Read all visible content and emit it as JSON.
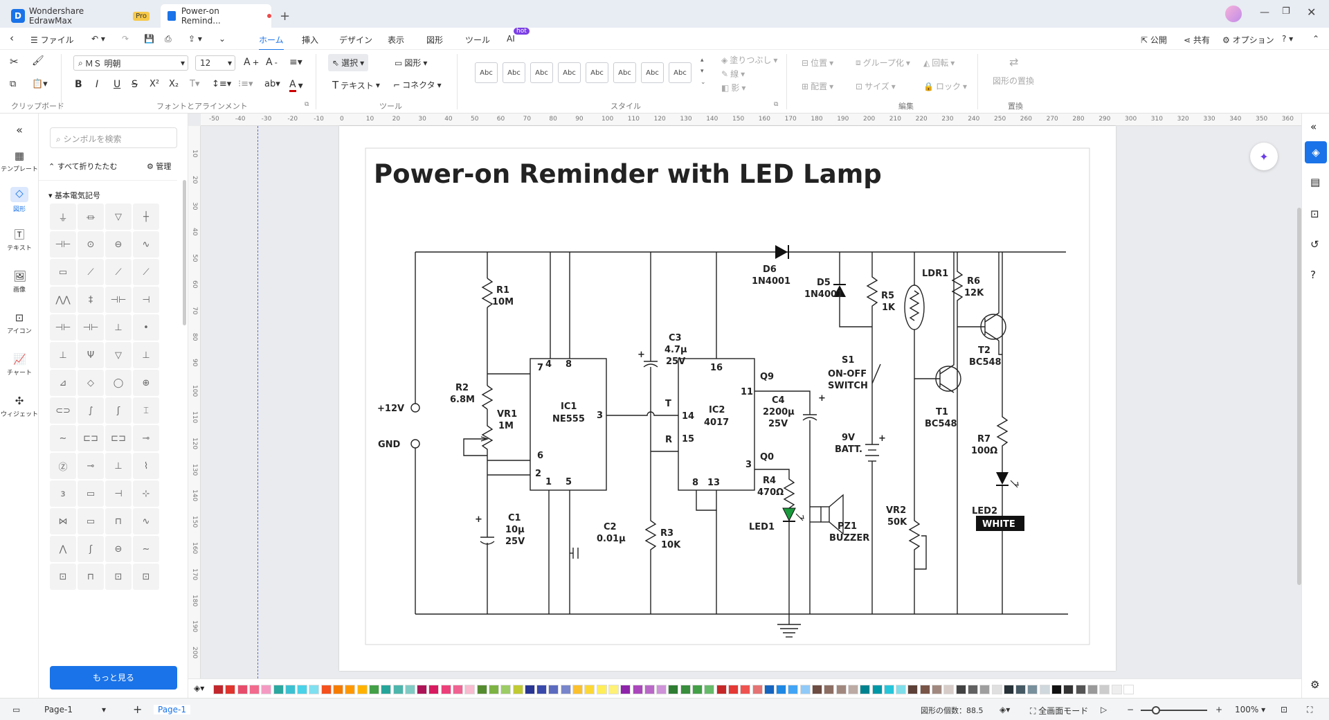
{
  "titlebar": {
    "app_name": "Wondershare EdrawMax",
    "pro_badge": "Pro",
    "doc_tab": "Power-on Remind...",
    "new_tab": "+"
  },
  "menubar": {
    "file": "ファイル",
    "tabs": [
      "ホーム",
      "挿入",
      "デザイン",
      "表示",
      "図形",
      "ツール",
      "AI"
    ],
    "ai_badge": "hot",
    "publish": "公開",
    "share": "共有",
    "options": "オプション"
  },
  "ribbon": {
    "font_name": "ＭＳ 明朝",
    "font_size": "12",
    "select": "選択",
    "shape": "図形",
    "text": "テキスト",
    "connector": "コネクタ",
    "style_swatch": "Abc",
    "fill": "塗りつぶし",
    "line": "線",
    "shadow": "影",
    "position": "位置",
    "align": "配置",
    "group": "グループ化",
    "size": "サイズ",
    "rotate": "回転",
    "lock": "ロック",
    "replace_shape": "図形の置換",
    "groups": {
      "clipboard": "クリップボード",
      "font": "フォントとアラインメント",
      "tools": "ツール",
      "style": "スタイル",
      "edit": "編集",
      "replace": "置換"
    }
  },
  "leftbar": [
    "テンプレート",
    "図形",
    "テキスト",
    "画像",
    "アイコン",
    "チャート",
    "ウィジェット"
  ],
  "library": {
    "search_placeholder": "シンボルを検索",
    "collapse_all": "すべて折りたたむ",
    "manage": "管理",
    "category": "基本電気記号",
    "more": "もっと見る"
  },
  "ruler": {
    "h": [
      "-50",
      "-40",
      "-30",
      "-20",
      "-10",
      "0",
      "10",
      "20",
      "30",
      "40",
      "50",
      "60",
      "70",
      "80",
      "90",
      "100",
      "110",
      "120",
      "130",
      "140",
      "150",
      "160",
      "170",
      "180",
      "190",
      "200",
      "210",
      "220",
      "230",
      "240",
      "250",
      "260",
      "270",
      "280",
      "290",
      "300",
      "310",
      "320",
      "330",
      "340",
      "350",
      "360"
    ],
    "v": [
      "10",
      "20",
      "30",
      "40",
      "50",
      "60",
      "70",
      "80",
      "90",
      "100",
      "110",
      "120",
      "130",
      "140",
      "150",
      "160",
      "170",
      "180",
      "190",
      "200"
    ]
  },
  "diagram": {
    "title": "Power-on Reminder with LED Lamp",
    "labels": {
      "r1": "R1",
      "r1v": "10M",
      "r2": "R2",
      "r2v": "6.8M",
      "vr1": "VR1",
      "vr1v": "1M",
      "c1": "C1",
      "c1v": "10µ",
      "c1v2": "25V",
      "ic1": "IC1",
      "ic1v": "NE555",
      "c2": "C2",
      "c2v": "0.01µ",
      "c3": "C3",
      "c3v": "4.7µ",
      "c3v2": "25V",
      "r3": "R3",
      "r3v": "10K",
      "ic2": "IC2",
      "ic2v": "4017",
      "t": "T",
      "r": "R",
      "q9": "Q9",
      "q0": "Q0",
      "c4": "C4",
      "c4v": "2200µ",
      "c4v2": "25V",
      "r4": "R4",
      "r4v": "470Ω",
      "led1": "LED1",
      "d6": "D6",
      "d6v": "1N4001",
      "d5": "D5",
      "d5v": "1N4001",
      "r5": "R5",
      "r5v": "1K",
      "s1": "S1",
      "s1v": "ON-OFF",
      "s1v2": "SWITCH",
      "batt": "9V",
      "battv": "BATT.",
      "pz1": "PZ1",
      "pz1v": "BUZZER",
      "ldr1": "LDR1",
      "vr2": "VR2",
      "vr2v": "50K",
      "t1": "T1",
      "t1v": "BC548",
      "t2": "T2",
      "t2v": "BC548",
      "r6": "R6",
      "r6v": "12K",
      "r7": "R7",
      "r7v": "100Ω",
      "led2": "LED2",
      "white": "WHITE",
      "v12": "+12V",
      "gnd": "GND",
      "plus": "+",
      "p4": "4",
      "p8": "8",
      "p7": "7",
      "p3": "3",
      "p6": "6",
      "p2": "2",
      "p1": "1",
      "p5": "5",
      "p16": "16",
      "p11": "11",
      "p14": "14",
      "p15": "15",
      "p3b": "3",
      "p8b": "8",
      "p13": "13"
    }
  },
  "statusbar": {
    "page_selector": "Page-1",
    "page_tab": "Page-1",
    "shape_count": "図形の個数：88.5",
    "fullscreen": "全画面モード",
    "zoom": "100%"
  },
  "colors": {
    "accent": "#1a73e8",
    "led_green": "#1a9a3c"
  }
}
